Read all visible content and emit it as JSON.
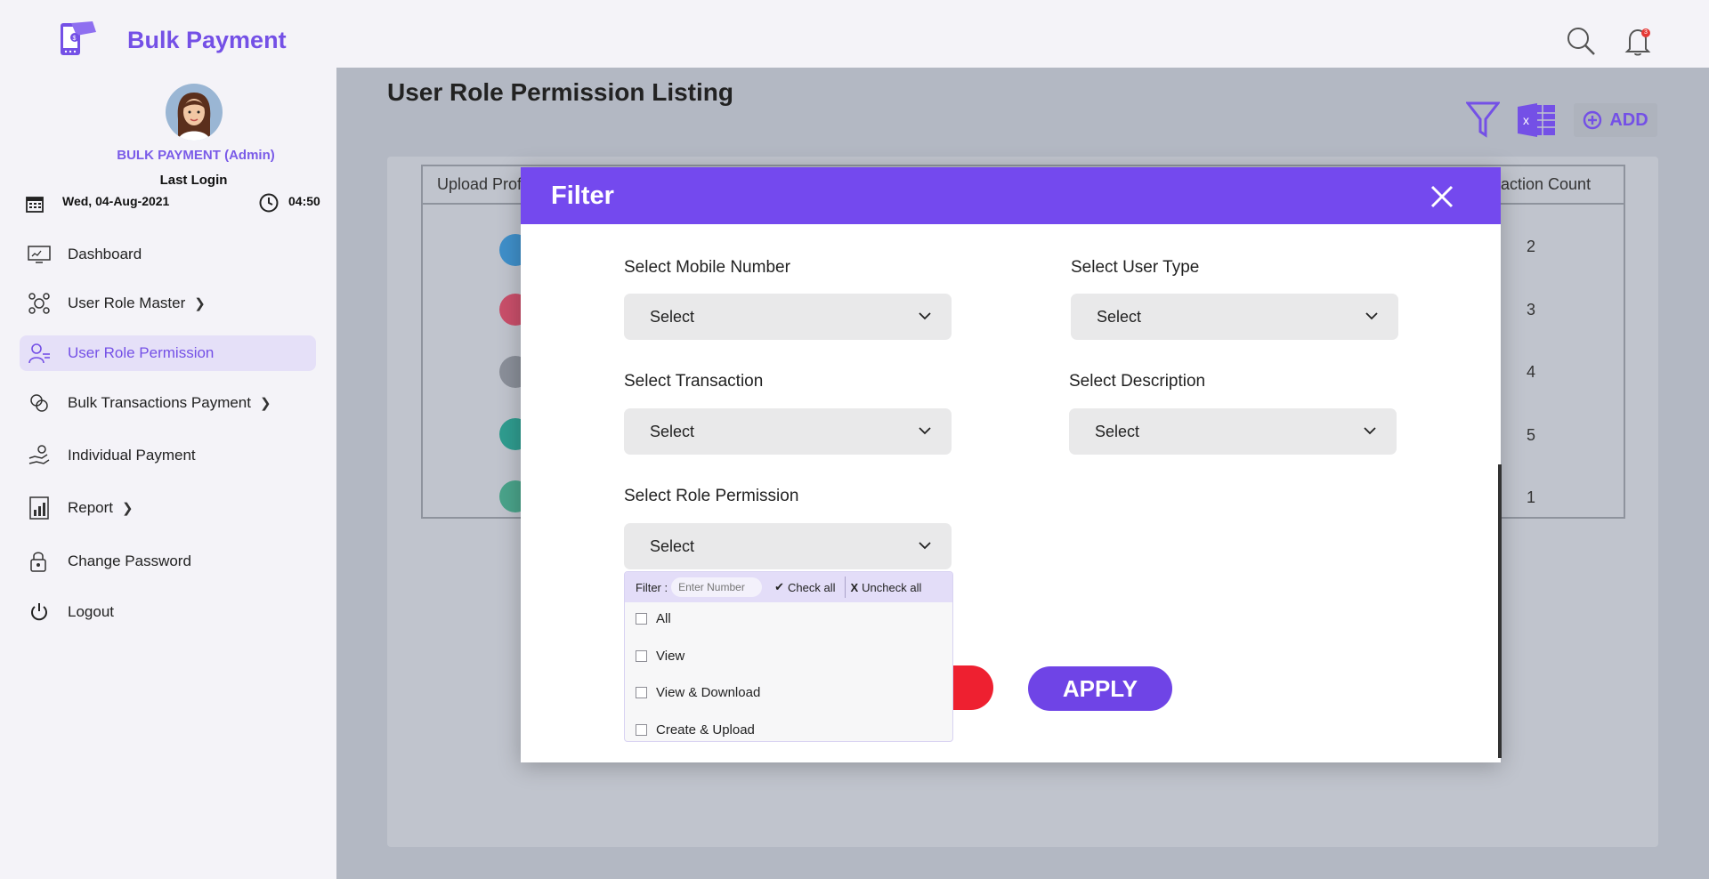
{
  "header": {
    "brand": "Bulk Payment",
    "notification_count": "3"
  },
  "user": {
    "name": "BULK PAYMENT (Admin)",
    "last_login_label": "Last Login",
    "date": "Wed, 04-Aug-2021",
    "time": "04:50"
  },
  "sidebar": {
    "items": [
      {
        "label": "Dashboard",
        "icon": "dashboard-icon",
        "active": false,
        "has_chevron": false
      },
      {
        "label": "User Role Master",
        "icon": "role-master-icon",
        "active": false,
        "has_chevron": true
      },
      {
        "label": "User Role Permission",
        "icon": "user-permission-icon",
        "active": true,
        "has_chevron": false
      },
      {
        "label": "Bulk Transactions Payment",
        "icon": "bulk-payment-icon",
        "active": false,
        "has_chevron": true
      },
      {
        "label": "Individual Payment",
        "icon": "individual-payment-icon",
        "active": false,
        "has_chevron": false
      },
      {
        "label": "Report",
        "icon": "report-icon",
        "active": false,
        "has_chevron": true
      },
      {
        "label": "Change Password",
        "icon": "change-password-icon",
        "active": false,
        "has_chevron": false
      },
      {
        "label": "Logout",
        "icon": "power-icon",
        "active": false,
        "has_chevron": false
      }
    ]
  },
  "page": {
    "title": "User Role Permission Listing",
    "add_label": "ADD",
    "table": {
      "col_first_visible": "Upload Profi",
      "col_last_visible": "action Count",
      "counts": [
        "2",
        "3",
        "4",
        "5",
        "1"
      ]
    }
  },
  "modal": {
    "title": "Filter",
    "fields": {
      "mobile": {
        "label": "Select Mobile Number",
        "value": "Select"
      },
      "user_type": {
        "label": "Select User Type",
        "value": "Select"
      },
      "transaction": {
        "label": "Select Transaction",
        "value": "Select"
      },
      "description": {
        "label": "Select Description",
        "value": "Select"
      },
      "role_permission": {
        "label": "Select Role Permission",
        "value": "Select"
      }
    },
    "clear_visible": "R",
    "apply_label": "APPLY",
    "dropdown": {
      "filter_label": "Filter :",
      "filter_placeholder": "Enter Number",
      "check_all": "Check all",
      "uncheck_all": "Uncheck all",
      "options": [
        "All",
        "View",
        "View & Download",
        "Create & Upload"
      ]
    }
  },
  "colors": {
    "accent": "#7449ee",
    "danger": "#ee2030",
    "active_bg": "#e5e0f8",
    "overlay": "#b3b8c3"
  }
}
